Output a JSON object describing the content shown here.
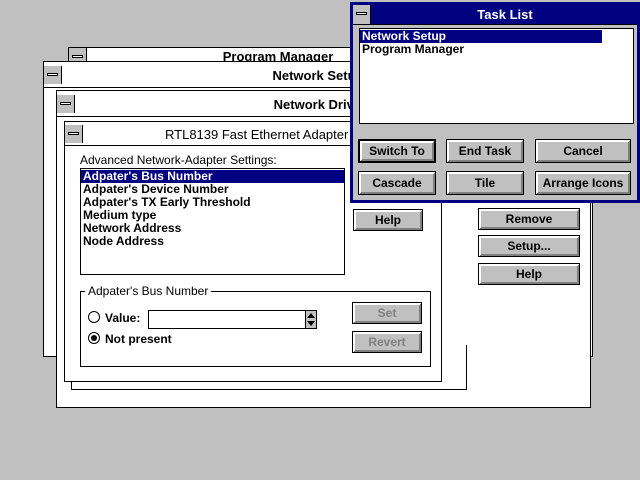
{
  "windows": {
    "program_manager": {
      "title": "Program Manager"
    },
    "network_setup": {
      "title": "Network Setup"
    },
    "network_drivers": {
      "title": "Network Drivers"
    },
    "adapter_dialog": {
      "title": "RTL8139 Fast Ethernet Adapter",
      "settings_label": "Advanced Network-Adapter Settings:",
      "settings_items": [
        "Adpater's Bus Number",
        "Adpater's Device Number",
        "Adpater's TX Early Threshold",
        "Medium type",
        "Network Address",
        "Node Address"
      ],
      "selected_index": 0,
      "help_label": "Help",
      "group_label": "Adpater's Bus Number",
      "value_radio_label": "Value:",
      "value_input": "",
      "not_present_label": "Not present",
      "selected_radio": "not_present",
      "set_label": "Set",
      "revert_label": "Revert"
    },
    "network_drivers_buttons": {
      "remove_label": "Remove",
      "setup_label": "Setup...",
      "help_label": "Help"
    },
    "task_list": {
      "title": "Task List",
      "tasks": [
        "Network Setup",
        "Program Manager"
      ],
      "selected_index": 0,
      "buttons": {
        "switch_to": "Switch To",
        "end_task": "End Task",
        "cancel": "Cancel",
        "cascade": "Cascade",
        "tile": "Tile",
        "arrange_icons": "Arrange Icons"
      }
    }
  }
}
